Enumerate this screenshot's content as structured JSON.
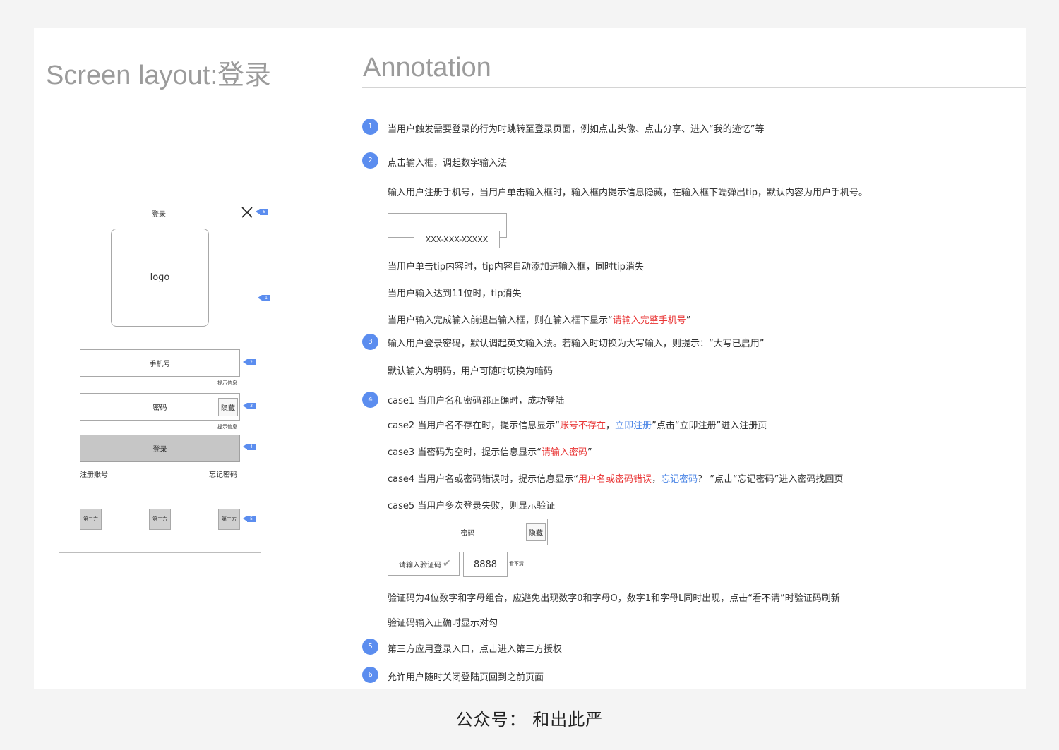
{
  "headings": {
    "left": "Screen layout:登录",
    "right": "Annotation"
  },
  "wireframe": {
    "title": "登录",
    "logo": "logo",
    "phone_field": "手机号",
    "phone_hint": "提示信息",
    "password_field": "密码",
    "hide_btn": "隐藏",
    "password_hint": "提示信息",
    "login_btn": "登录",
    "register_link": "注册账号",
    "forgot_link": "忘记密码",
    "third_party": [
      "第三方",
      "第三方",
      "第三方"
    ],
    "tags": [
      "6",
      "1",
      "2",
      "3",
      "4",
      "5"
    ]
  },
  "annotations": {
    "n1": "1",
    "a1": "当用户触发需要登录的行为时跳转至登录页面，例如点击头像、点击分享、进入“我的迹忆”等",
    "n2": "2",
    "a2": "点击输入框，调起数字输入法",
    "a2b": "输入用户注册手机号，当用户单击输入框时，输入框内提示信息隐藏，在输入框下端弹出tip，默认内容为用户手机号。",
    "tip_demo": "XXX-XXX-XXXXX",
    "a2c": "当用户单击tip内容时，tip内容自动添加进输入框，同时tip消失",
    "a2d": "当用户输入达到11位时，tip消失",
    "a2e_pre": "当用户输入完成输入前退出输入框，则在输入框下显示“",
    "a2e_red": "请输入完整手机号",
    "a2e_post": "”",
    "n3": "3",
    "a3": "输入用户登录密码，默认调起英文输入法。若输入时切换为大写输入，则提示：“大写已启用”",
    "a3b": "默认输入为明码，用户可随时切换为暗码",
    "n4": "4",
    "c1": "case1 当用户名和密码都正确时，成功登陆",
    "c2_pre": "case2 当用户名不存在时，提示信息显示“",
    "c2_red": "账号不存在",
    "c2_sep": "，",
    "c2_blue": "立即注册",
    "c2_post": "”点击“立即注册”进入注册页",
    "c3_pre": "case3 当密码为空时，提示信息显示“",
    "c3_red": "请输入密码",
    "c3_post": "”",
    "c4_pre": "case4 当用户名或密码错误时，提示信息显示“",
    "c4_red": "用户名或密码错误",
    "c4_sep": "，",
    "c4_blue": "忘记密码",
    "c4_post": "？ ”点击“忘记密码”进入密码找回页",
    "c5": "case5 当用户多次登录失败，则显示验证",
    "demo_password": "密码",
    "demo_hide": "隐藏",
    "demo_captcha_placeholder": "请输入验证码",
    "demo_captcha_code": "8888",
    "demo_refresh": "看不清",
    "c5b": "验证码为4位数字和字母组合，应避免出现数字0和字母O，数字1和字母L同时出现，点击“看不清”时验证码刷新",
    "c5c": "验证码输入正确时显示对勾",
    "n5": "5",
    "a5": "第三方应用登录入口，点击进入第三方授权",
    "n6": "6",
    "a6": "允许用户随时关闭登陆页回到之前页面"
  },
  "footer": "公众号：  和出此严",
  "colors": {
    "accent": "#5b8def",
    "error": "#e93636",
    "link": "#4c86e6"
  }
}
